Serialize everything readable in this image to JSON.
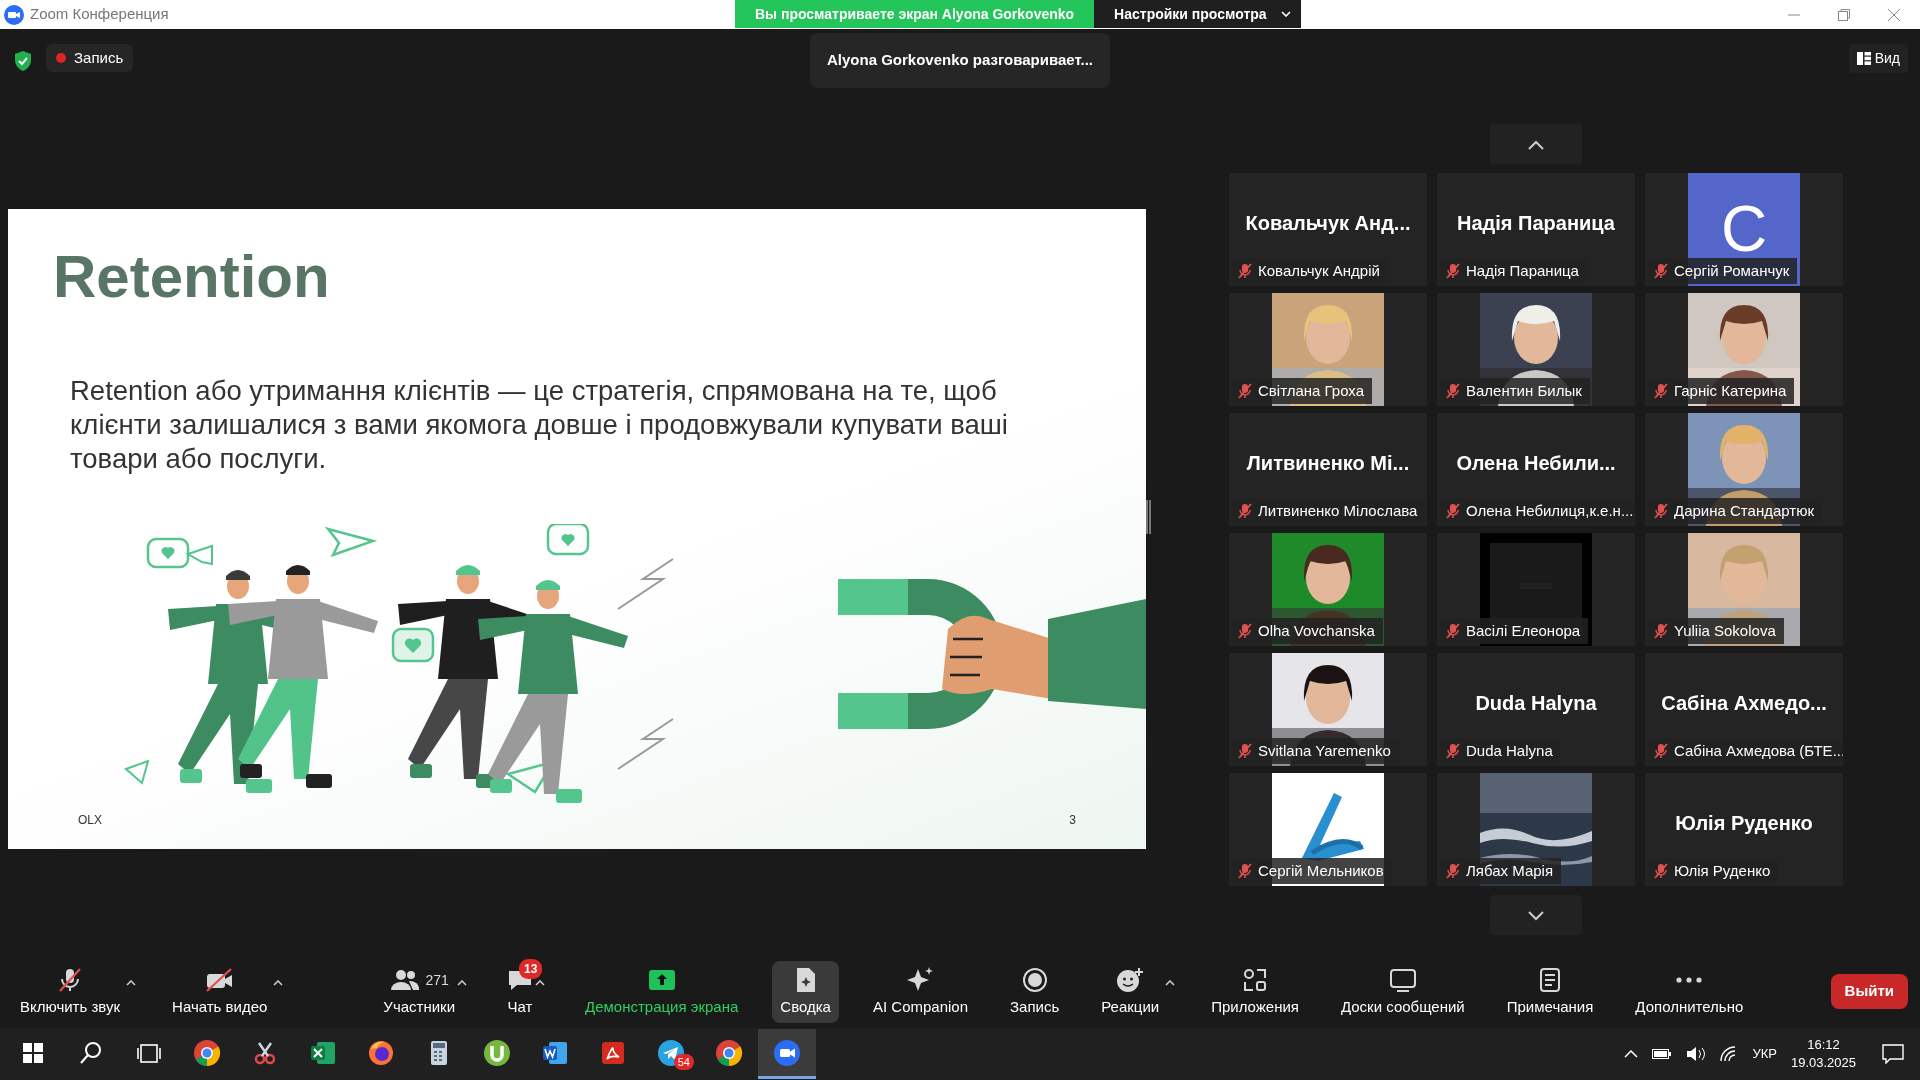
{
  "window": {
    "title": "Zoom Конференция"
  },
  "banner": {
    "text": "Вы просматриваете экран Alyona Gorkovenko",
    "menu": "Настройки просмотра"
  },
  "recording": {
    "label": "Запись",
    "on": true
  },
  "talking": "Alyona Gorkovenko разговаривает...",
  "view_button": "Вид",
  "slide": {
    "title": "Retention",
    "body": "Retention або утримання клієнтів — це стратегія, спрямована на те, щоб клієнти залишалися з вами якомога довше і продовжували купувати ваші товари або послуги.",
    "footer": "OLX",
    "page": "3"
  },
  "participants": [
    {
      "kind": "name",
      "display": "Ковальчук Анд...",
      "name": "Ковальчук Андрій",
      "muted": true
    },
    {
      "kind": "name",
      "display": "Надія Параница",
      "name": "Надія Параница",
      "muted": true
    },
    {
      "kind": "letter",
      "display": "С",
      "name": "Сергій Романчук",
      "muted": true
    },
    {
      "kind": "picture",
      "name": "Світлана Гроха",
      "muted": true
    },
    {
      "kind": "picture",
      "name": "Валентин Билык",
      "muted": true
    },
    {
      "kind": "picture",
      "name": "Гарніс Катерина",
      "muted": true
    },
    {
      "kind": "name",
      "display": "Литвиненко Мі...",
      "name": "Литвиненко Мілослава",
      "muted": true
    },
    {
      "kind": "name",
      "display": "Олена Небили...",
      "name": "Олена Небилиця,к.е.н....",
      "muted": true
    },
    {
      "kind": "picture",
      "name": "Дарина Стандартюк",
      "muted": true
    },
    {
      "kind": "picture",
      "name": "Olha Vovchanska",
      "muted": true
    },
    {
      "kind": "picture",
      "name": "Васілі Елеонора",
      "muted": true
    },
    {
      "kind": "picture",
      "name": "Yuliia Sokolova",
      "muted": true
    },
    {
      "kind": "picture",
      "name": "Svitlana Yaremenko",
      "muted": true
    },
    {
      "kind": "name",
      "display": "Duda Halyna",
      "name": "Duda Halyna",
      "muted": true
    },
    {
      "kind": "name",
      "display": "Сабіна Ахмедо...",
      "name": "Сабіна Ахмедова (БТЕ...",
      "muted": true
    },
    {
      "kind": "picture",
      "name": "Сергій Мельников",
      "muted": true
    },
    {
      "kind": "picture",
      "name": "Лябах Марія",
      "muted": true
    },
    {
      "kind": "name",
      "display": "Юлія Руденко",
      "name": "Юлія Руденко",
      "muted": true
    }
  ],
  "toolbar": [
    {
      "kind": "mic-off",
      "label": "Включить звук",
      "caret": true,
      "selected": false
    },
    {
      "kind": "video-off",
      "label": "Начать видео",
      "caret": true,
      "selected": false
    },
    {
      "kind": "participants",
      "label": "Участники",
      "count": "271",
      "caret": true,
      "selected": false
    },
    {
      "kind": "chat",
      "label": "Чат",
      "badge": "13",
      "caret": true,
      "selected": false
    },
    {
      "kind": "share",
      "label": "Демонстрация экрана",
      "caret": false,
      "selected": false
    },
    {
      "kind": "summary",
      "label": "Сводка",
      "caret": false,
      "selected": true
    },
    {
      "kind": "ai",
      "label": "AI Companion",
      "caret": false,
      "selected": false
    },
    {
      "kind": "record",
      "label": "Запись",
      "caret": false,
      "selected": false
    },
    {
      "kind": "reactions",
      "label": "Реакции",
      "caret": true,
      "selected": false
    },
    {
      "kind": "apps",
      "label": "Приложения",
      "caret": false,
      "selected": false
    },
    {
      "kind": "whiteboards",
      "label": "Доски сообщений",
      "caret": false,
      "selected": false
    },
    {
      "kind": "notes",
      "label": "Примечания",
      "caret": false,
      "selected": false
    },
    {
      "kind": "more",
      "label": "Дополнительно",
      "caret": false,
      "selected": false
    }
  ],
  "leave_button": "Выйти",
  "taskbar": {
    "apps": [
      {
        "kind": "start",
        "selected": false
      },
      {
        "kind": "search",
        "selected": false
      },
      {
        "kind": "taskview",
        "selected": false
      },
      {
        "kind": "chrome",
        "selected": false
      },
      {
        "kind": "snip",
        "selected": false
      },
      {
        "kind": "excel",
        "selected": false
      },
      {
        "kind": "firefox",
        "selected": false
      },
      {
        "kind": "calculator",
        "selected": false
      },
      {
        "kind": "torrent",
        "selected": false
      },
      {
        "kind": "word",
        "selected": false
      },
      {
        "kind": "acrobat",
        "selected": false
      },
      {
        "kind": "telegram",
        "badge": "54",
        "selected": false
      },
      {
        "kind": "chrome",
        "selected": false
      },
      {
        "kind": "zoom",
        "selected": true
      }
    ],
    "language": "УКР",
    "time": "16:12",
    "date": "19.03.2025"
  }
}
